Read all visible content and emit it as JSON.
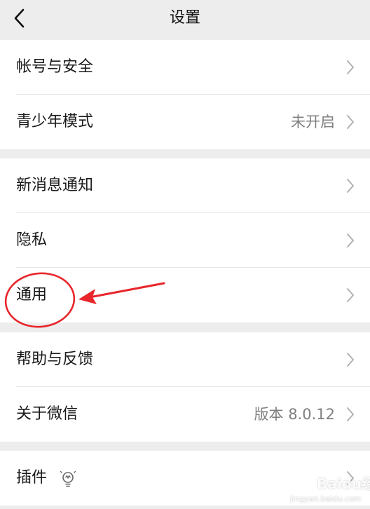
{
  "nav": {
    "title": "设置",
    "back_icon": "chevron-left-icon"
  },
  "groups": [
    {
      "items": [
        {
          "label": "帐号与安全",
          "value": ""
        },
        {
          "label": "青少年模式",
          "value": "未开启"
        }
      ]
    },
    {
      "items": [
        {
          "label": "新消息通知",
          "value": ""
        },
        {
          "label": "隐私",
          "value": ""
        },
        {
          "label": "通用",
          "value": ""
        }
      ]
    },
    {
      "items": [
        {
          "label": "帮助与反馈",
          "value": ""
        },
        {
          "label": "关于微信",
          "value": "版本 8.0.12"
        }
      ]
    },
    {
      "items": [
        {
          "label": "插件",
          "value": "",
          "icon": "lightbulb-icon"
        }
      ]
    }
  ],
  "annotation": {
    "color": "#e8262b",
    "target": "通用"
  },
  "watermark": {
    "brand": "Baidu经验",
    "url": "jingyan.baidu.com"
  },
  "colors": {
    "background": "#ededed",
    "row": "#ffffff",
    "text": "#1a1a1a",
    "secondary": "#7f7f7f",
    "chevron": "#b2b2b2"
  }
}
